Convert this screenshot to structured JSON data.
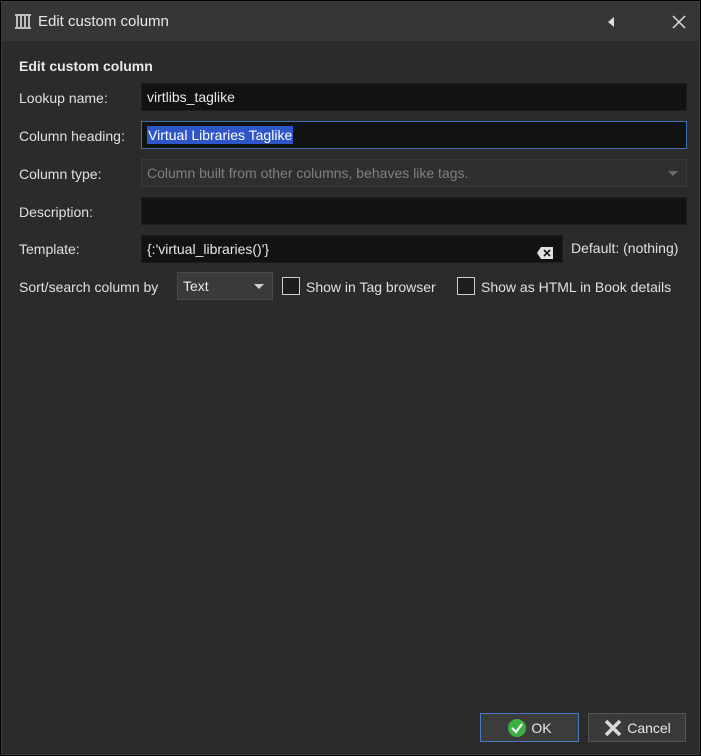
{
  "window": {
    "title": "Edit custom column"
  },
  "form": {
    "heading": "Edit custom column",
    "lookup_label": "Lookup name:",
    "lookup_value": "virtlibs_taglike",
    "heading_label": "Column heading:",
    "heading_value": "Virtual  Libraries Taglike",
    "type_label": "Column type:",
    "type_value": "Column built from other columns, behaves like tags.",
    "description_label": "Description:",
    "description_value": "",
    "template_label": "Template:",
    "template_value": "{:'virtual_libraries()'}",
    "template_default": "Default: (nothing)",
    "sort_label": "Sort/search column by",
    "sort_value": "Text",
    "show_tag_browser_label": "Show in Tag browser",
    "show_tag_browser_checked": false,
    "show_html_label": "Show as HTML in Book details",
    "show_html_checked": false
  },
  "buttons": {
    "ok_label": "OK",
    "cancel_label": "Cancel"
  },
  "colors": {
    "background": "#2b2b2b",
    "titlebar": "#363636",
    "selection": "#2f56c9",
    "focus_border": "#3f6fb5",
    "ok_icon": "#3cb043",
    "cancel_icon": "#d8d8d8"
  },
  "icons": {
    "app": "library-columns-icon",
    "collapse": "triangle-left-icon",
    "close": "close-icon",
    "clear": "clear-input-icon",
    "ok": "check-circle-icon",
    "cancel": "x-mark-icon"
  }
}
